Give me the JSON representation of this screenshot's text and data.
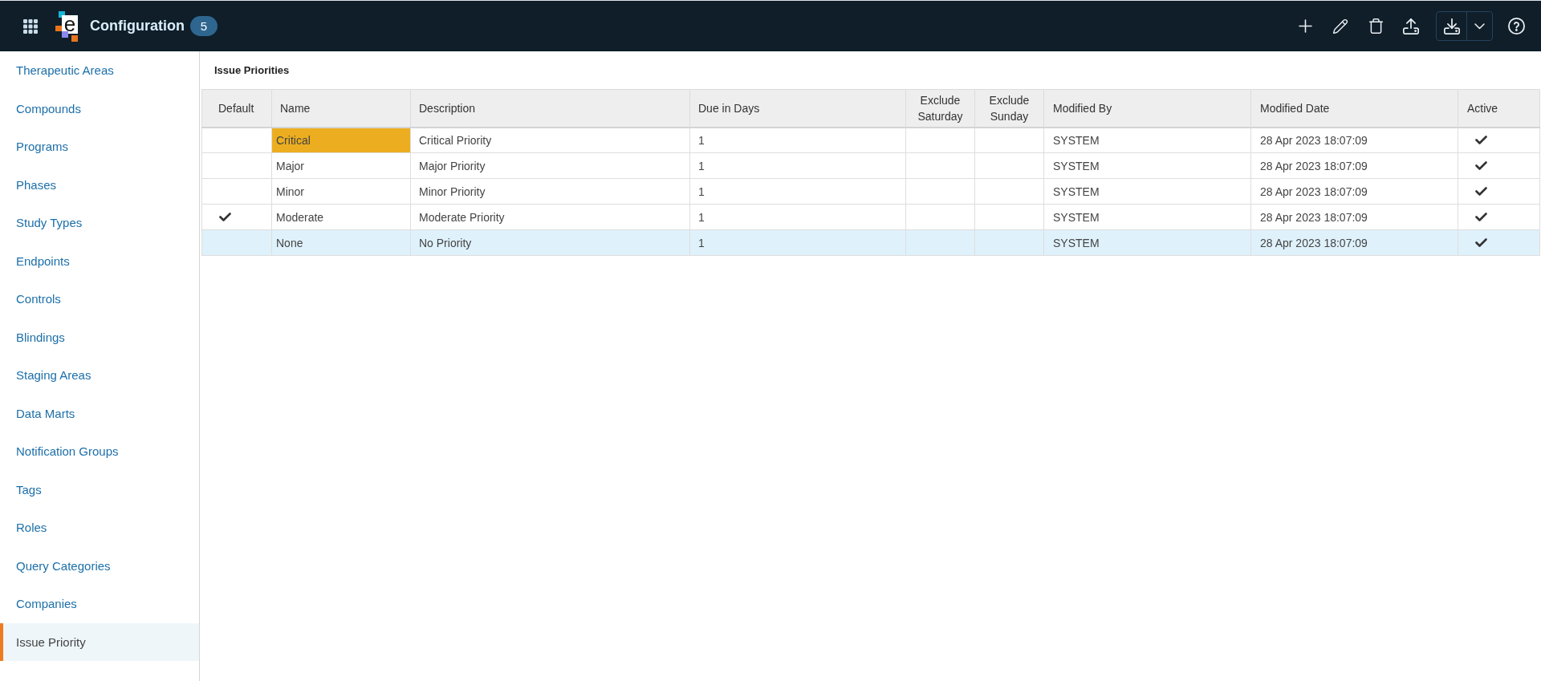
{
  "app_bar": {
    "logo_text": "e",
    "title": "Configuration",
    "badge": "5"
  },
  "sidebar": {
    "items": [
      {
        "label": "Therapeutic Areas",
        "selected": false
      },
      {
        "label": "Compounds",
        "selected": false
      },
      {
        "label": "Programs",
        "selected": false
      },
      {
        "label": "Phases",
        "selected": false
      },
      {
        "label": "Study Types",
        "selected": false
      },
      {
        "label": "Endpoints",
        "selected": false
      },
      {
        "label": "Controls",
        "selected": false
      },
      {
        "label": "Blindings",
        "selected": false
      },
      {
        "label": "Staging Areas",
        "selected": false
      },
      {
        "label": "Data Marts",
        "selected": false
      },
      {
        "label": "Notification Groups",
        "selected": false
      },
      {
        "label": "Tags",
        "selected": false
      },
      {
        "label": "Roles",
        "selected": false
      },
      {
        "label": "Query Categories",
        "selected": false
      },
      {
        "label": "Companies",
        "selected": false
      },
      {
        "label": "Issue Priority",
        "selected": true
      }
    ]
  },
  "panel": {
    "title": "Issue Priorities"
  },
  "table": {
    "columns": [
      "Default",
      "Name",
      "Description",
      "Due in Days",
      "Exclude Saturday",
      "Exclude Sunday",
      "Modified By",
      "Modified Date",
      "Active"
    ],
    "rows": [
      {
        "default": false,
        "name": "Critical",
        "color": "#ecae20",
        "description": "Critical Priority",
        "due_in_days": "1",
        "exclude_saturday": false,
        "exclude_sunday": false,
        "modified_by": "SYSTEM",
        "modified_date": "28 Apr 2023 18:07:09",
        "active": true,
        "selected": false
      },
      {
        "default": false,
        "name": "Major",
        "description": "Major Priority",
        "due_in_days": "1",
        "exclude_saturday": false,
        "exclude_sunday": false,
        "modified_by": "SYSTEM",
        "modified_date": "28 Apr 2023 18:07:09",
        "active": true,
        "selected": false
      },
      {
        "default": false,
        "name": "Minor",
        "description": "Minor Priority",
        "due_in_days": "1",
        "exclude_saturday": false,
        "exclude_sunday": false,
        "modified_by": "SYSTEM",
        "modified_date": "28 Apr 2023 18:07:09",
        "active": true,
        "selected": false
      },
      {
        "default": true,
        "name": "Moderate",
        "description": "Moderate Priority",
        "due_in_days": "1",
        "exclude_saturday": false,
        "exclude_sunday": false,
        "modified_by": "SYSTEM",
        "modified_date": "28 Apr 2023 18:07:09",
        "active": true,
        "selected": false
      },
      {
        "default": false,
        "name": "None",
        "description": "No Priority",
        "due_in_days": "1",
        "exclude_saturday": false,
        "exclude_sunday": false,
        "modified_by": "SYSTEM",
        "modified_date": "28 Apr 2023 18:07:09",
        "active": true,
        "selected": true
      }
    ]
  }
}
